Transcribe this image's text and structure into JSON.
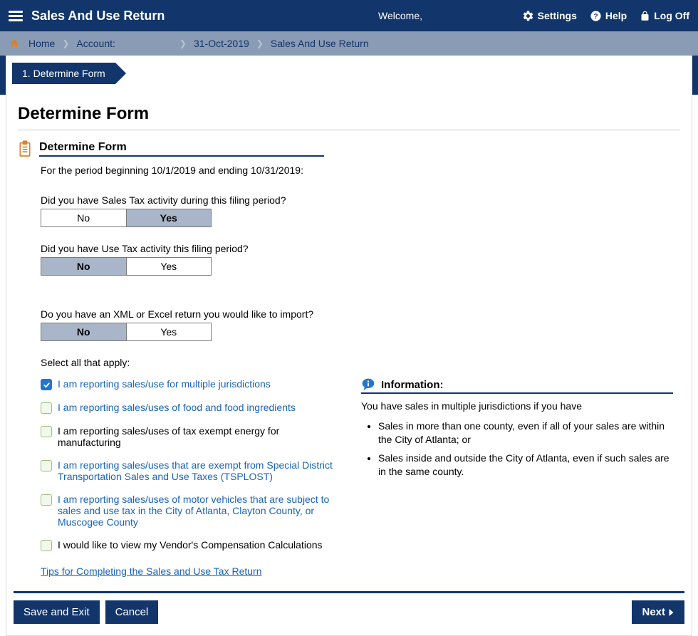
{
  "header": {
    "app_title": "Sales And Use Return",
    "welcome": "Welcome,",
    "settings": "Settings",
    "help": "Help",
    "logoff": "Log Off"
  },
  "breadcrumb": {
    "home": "Home",
    "account": "Account:",
    "date": "31-Oct-2019",
    "page": "Sales And Use Return"
  },
  "step_label": "1. Determine Form",
  "page_title": "Determine Form",
  "section_title": "Determine Form",
  "period_text": "For the period beginning 10/1/2019 and ending 10/31/2019:",
  "questions": {
    "sales": {
      "text": "Did you have Sales Tax activity during this filing period?",
      "no": "No",
      "yes": "Yes",
      "selected": "yes"
    },
    "use": {
      "text": "Did you have Use Tax activity this filing period?",
      "no": "No",
      "yes": "Yes",
      "selected": "no"
    },
    "import": {
      "text": "Do you have an XML or Excel return you would like to import?",
      "no": "No",
      "yes": "Yes",
      "selected": "no"
    }
  },
  "select_all_label": "Select all that apply:",
  "checks": [
    {
      "label": "I am reporting sales/use for multiple jurisdictions",
      "checked": true,
      "link": true
    },
    {
      "label": "I am reporting sales/uses of food and food ingredients",
      "checked": false,
      "link": true
    },
    {
      "label": "I am reporting sales/uses of tax exempt energy for manufacturing",
      "checked": false,
      "link": false
    },
    {
      "label": "I am reporting sales/uses that are exempt from Special District Transportation Sales and Use Taxes (TSPLOST)",
      "checked": false,
      "link": true
    },
    {
      "label": "I am reporting sales/uses of motor vehicles that are subject to sales and use tax in the City of Atlanta, Clayton County, or Muscogee County",
      "checked": false,
      "link": true
    },
    {
      "label": "I would like to view my Vendor's Compensation Calculations",
      "checked": false,
      "link": false
    }
  ],
  "tips_link": "Tips for Completing the Sales and Use Tax Return",
  "info": {
    "title": "Information:",
    "intro": "You have sales in multiple jurisdictions if you have",
    "bullets": [
      "Sales in more than one county, even if all of your sales are within the City of Atlanta; or",
      "Sales inside and outside the City of Atlanta, even if such sales are in the same county."
    ]
  },
  "footer": {
    "save": "Save and Exit",
    "cancel": "Cancel",
    "next": "Next"
  }
}
